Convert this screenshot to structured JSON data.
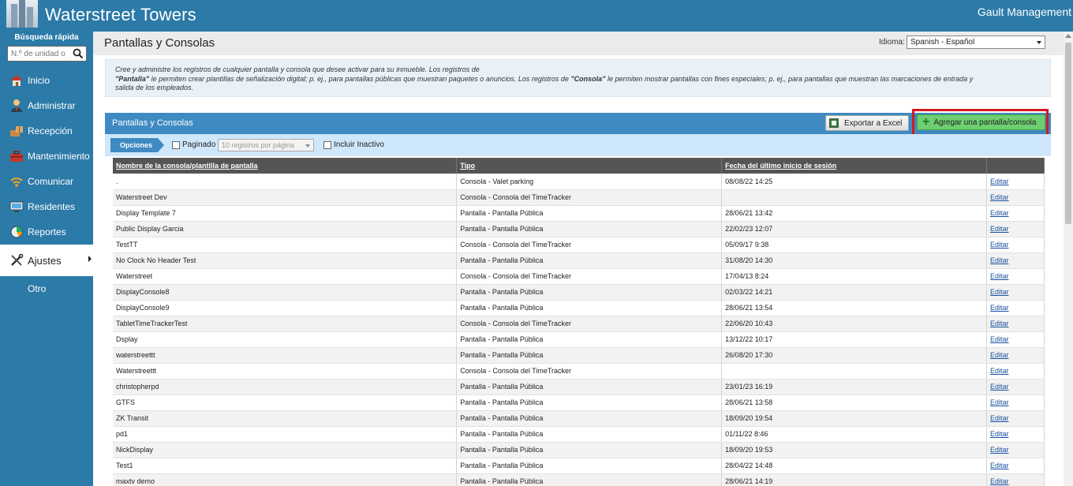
{
  "header": {
    "app_title": "Waterstreet Towers",
    "company": "Gault Management"
  },
  "sidebar": {
    "quick_search_label": "Búsqueda rápida",
    "quick_search_placeholder": "N.º de unidad o",
    "items": [
      {
        "label": "Inicio",
        "icon": "house-icon"
      },
      {
        "label": "Administrar",
        "icon": "person-icon"
      },
      {
        "label": "Recepción",
        "icon": "package-icon"
      },
      {
        "label": "Mantenimiento",
        "icon": "toolbox-icon"
      },
      {
        "label": "Comunicar",
        "icon": "wifi-icon"
      },
      {
        "label": "Residentes",
        "icon": "monitor-icon"
      },
      {
        "label": "Reportes",
        "icon": "pie-chart-icon"
      },
      {
        "label": "Ajustes",
        "icon": "tools-icon",
        "active": true
      },
      {
        "label": "Otro",
        "icon": ""
      }
    ]
  },
  "page": {
    "title": "Pantallas y Consolas",
    "language_label": "Idioma:",
    "language_value": "Spanish - Español",
    "description": {
      "line1": "Cree y administre los registros de cualquier pantalla y consola que desee activar para su inmueble. Los registros de",
      "pantalla_term": "\"Pantalla\"",
      "line2a": " le permiten crear plantillas de señalización digital; p. ej., para pantallas públicas que muestran paquetes o anuncios. Los registros de ",
      "consola_term": "\"Consola\"",
      "line2b": " le permiten mostrar pantallas con fines especiales; p. ej., para pantallas que muestran las marcaciones de entrada y",
      "line3": "salida de los empleados."
    }
  },
  "panel": {
    "title": "Pantallas y Consolas",
    "export_label": "Exportar a Excel",
    "add_label": "Agregar una pantalla/consola",
    "options_label": "Opciones",
    "paged_label": "Paginado",
    "page_size": "10 registros por página",
    "include_inactive_label": "Incluir Inactivo"
  },
  "table": {
    "columns": [
      "Nombre de la consola/plantilla de pantalla",
      "Tipo",
      "Fecha del último inicio de sesión",
      ""
    ],
    "edit_label": "Editar",
    "rows": [
      [
        ".",
        "Consola - Valet parking",
        "08/08/22 14:25"
      ],
      [
        "Waterstreet Dev",
        "Consola - Consola del TimeTracker",
        ""
      ],
      [
        "Display Template 7",
        "Pantalla - Pantalla Pública",
        "28/06/21 13:42"
      ],
      [
        "Public Display Garcia",
        "Pantalla - Pantalla Pública",
        "22/02/23 12:07"
      ],
      [
        "TestTT",
        "Consola - Consola del TimeTracker",
        "05/09/17 9:38"
      ],
      [
        "No Clock No Header Test",
        "Pantalla - Pantalla Pública",
        "31/08/20 14:30"
      ],
      [
        "Waterstreet",
        "Consola - Consola del TimeTracker",
        "17/04/13 8:24"
      ],
      [
        "DisplayConsole8",
        "Pantalla - Pantalla Pública",
        "02/03/22 14:21"
      ],
      [
        "DisplayConsole9",
        "Pantalla - Pantalla Pública",
        "28/06/21 13:54"
      ],
      [
        "TabletTimeTrackerTest",
        "Consola - Consola del TimeTracker",
        "22/06/20 10:43"
      ],
      [
        "Dsplay",
        "Pantalla - Pantalla Pública",
        "13/12/22 10:17"
      ],
      [
        "waterstreettt",
        "Pantalla - Pantalla Pública",
        "26/08/20 17:30"
      ],
      [
        "Waterstreettt",
        "Consola - Consola del TimeTracker",
        ""
      ],
      [
        "christopherpd",
        "Pantalla - Pantalla Pública",
        "23/01/23 16:19"
      ],
      [
        "GTFS",
        "Pantalla - Pantalla Pública",
        "28/06/21 13:58"
      ],
      [
        "ZK Transit",
        "Pantalla - Pantalla Pública",
        "18/09/20 19:54"
      ],
      [
        "pd1",
        "Pantalla - Pantalla Pública",
        "01/11/22 8:46"
      ],
      [
        "NickDisplay",
        "Pantalla - Pantalla Pública",
        "18/09/20 19:53"
      ],
      [
        "Test1",
        "Pantalla - Pantalla Pública",
        "28/04/22 14:48"
      ],
      [
        "maxtv demo",
        "Pantalla - Pantalla Pública",
        "28/06/21 14:19"
      ]
    ]
  }
}
